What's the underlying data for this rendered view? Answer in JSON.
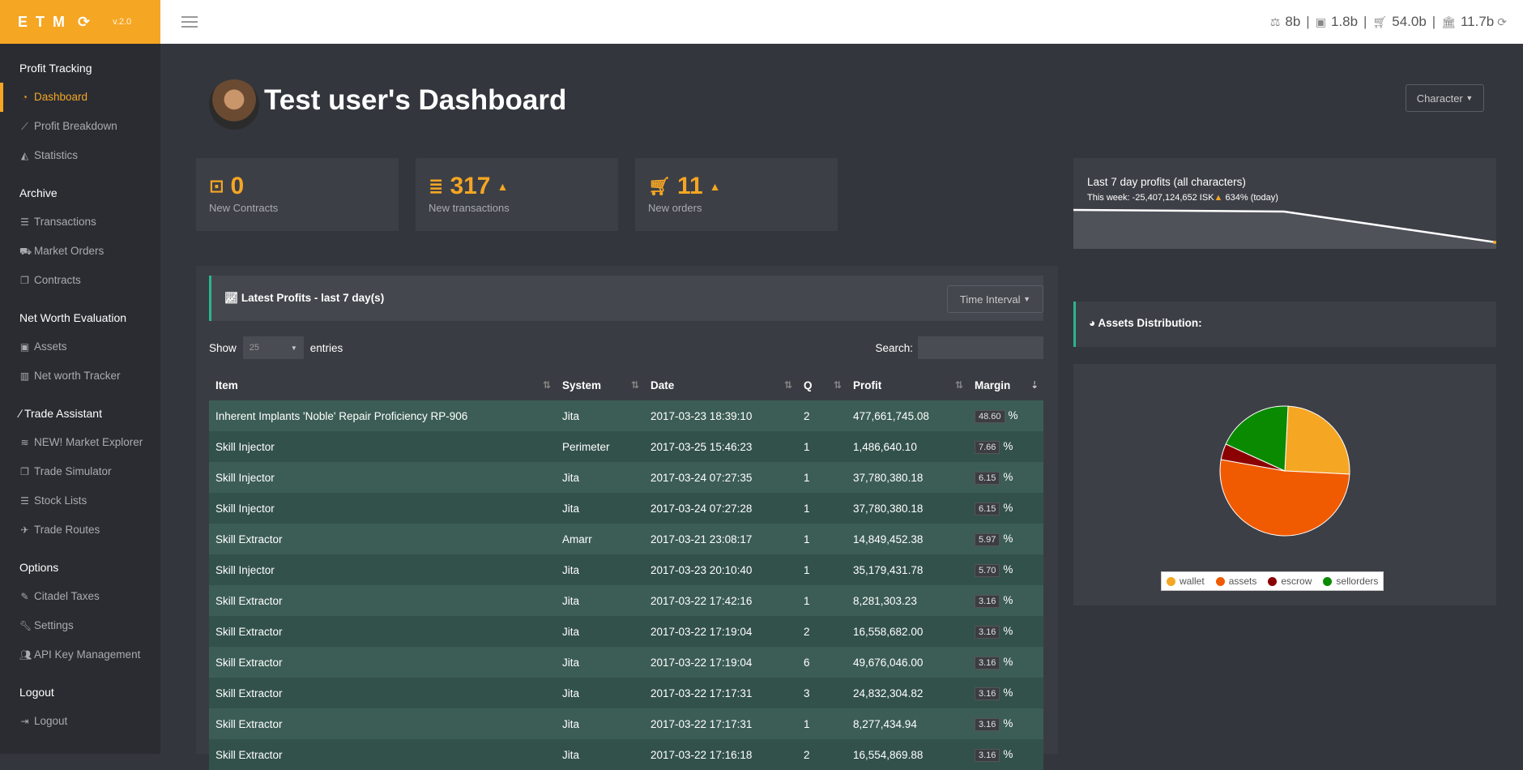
{
  "brand": {
    "name": "ETM",
    "version": "v.2.0"
  },
  "topbar": {
    "stats": [
      {
        "icon": "balance-icon",
        "value": "8b"
      },
      {
        "icon": "briefcase-icon",
        "value": "1.8b"
      },
      {
        "icon": "cart-icon",
        "value": "54.0b"
      },
      {
        "icon": "bank-icon",
        "value": "11.7b"
      }
    ]
  },
  "sidebar": {
    "sections": [
      {
        "title": "Profit Tracking",
        "items": [
          {
            "label": "Dashboard",
            "icon": "dashboard-icon",
            "active": true
          },
          {
            "label": "Profit Breakdown",
            "icon": "line-chart-icon"
          },
          {
            "label": "Statistics",
            "icon": "area-chart-icon"
          }
        ]
      },
      {
        "title": "Archive",
        "items": [
          {
            "label": "Transactions",
            "icon": "list-icon"
          },
          {
            "label": "Market Orders",
            "icon": "cart-icon"
          },
          {
            "label": "Contracts",
            "icon": "copy-icon"
          }
        ]
      },
      {
        "title": "Net Worth Evaluation",
        "items": [
          {
            "label": "Assets",
            "icon": "briefcase-icon"
          },
          {
            "label": "Net worth Tracker",
            "icon": "bar-chart-icon"
          }
        ]
      },
      {
        "title": "Trade Assistant",
        "items": [
          {
            "label": "NEW! Market Explorer",
            "icon": "database-icon"
          },
          {
            "label": "Trade Simulator",
            "icon": "copy-icon"
          },
          {
            "label": "Stock Lists",
            "icon": "list-icon"
          },
          {
            "label": "Trade Routes",
            "icon": "plane-icon"
          }
        ]
      },
      {
        "title": "Options",
        "items": [
          {
            "label": "Citadel Taxes",
            "icon": "pencil-icon"
          },
          {
            "label": "Settings",
            "icon": "wrench-icon"
          },
          {
            "label": "API Key Management",
            "icon": "users-icon"
          }
        ]
      },
      {
        "title": "Logout",
        "items": [
          {
            "label": "Logout",
            "icon": "sign-out-icon"
          }
        ]
      }
    ]
  },
  "header": {
    "title": "Test user's Dashboard",
    "character_button": "Character"
  },
  "cards": [
    {
      "icon": "contract-icon",
      "value": "0",
      "label": "New Contracts",
      "trend": ""
    },
    {
      "icon": "transactions-icon",
      "value": "317",
      "label": "New transactions",
      "trend": "up"
    },
    {
      "icon": "cart-icon",
      "value": "11",
      "label": "New orders",
      "trend": "up"
    }
  ],
  "profit_chart": {
    "title": "Last 7 day profits (all characters)",
    "subtitle_prefix": "This week: -25,407,124,652 ISK",
    "subtitle_suffix": "634% (today)"
  },
  "latest_profits": {
    "title": "Latest Profits - last 7 day(s)",
    "time_interval_button": "Time Interval",
    "show_label": "Show",
    "entries_value": "25",
    "entries_label": "entries",
    "search_label": "Search:",
    "columns": [
      "Item",
      "System",
      "Date",
      "Q",
      "Profit",
      "Margin"
    ],
    "rows": [
      [
        "Inherent Implants 'Noble' Repair Proficiency RP-906",
        "Jita",
        "2017-03-23 18:39:10",
        "2",
        "477,661,745.08",
        "48.60"
      ],
      [
        "Skill Injector",
        "Perimeter",
        "2017-03-25 15:46:23",
        "1",
        "1,486,640.10",
        "7.66"
      ],
      [
        "Skill Injector",
        "Jita",
        "2017-03-24 07:27:35",
        "1",
        "37,780,380.18",
        "6.15"
      ],
      [
        "Skill Injector",
        "Jita",
        "2017-03-24 07:27:28",
        "1",
        "37,780,380.18",
        "6.15"
      ],
      [
        "Skill Extractor",
        "Amarr",
        "2017-03-21 23:08:17",
        "1",
        "14,849,452.38",
        "5.97"
      ],
      [
        "Skill Injector",
        "Jita",
        "2017-03-23 20:10:40",
        "1",
        "35,179,431.78",
        "5.70"
      ],
      [
        "Skill Extractor",
        "Jita",
        "2017-03-22 17:42:16",
        "1",
        "8,281,303.23",
        "3.16"
      ],
      [
        "Skill Extractor",
        "Jita",
        "2017-03-22 17:19:04",
        "2",
        "16,558,682.00",
        "3.16"
      ],
      [
        "Skill Extractor",
        "Jita",
        "2017-03-22 17:19:04",
        "6",
        "49,676,046.00",
        "3.16"
      ],
      [
        "Skill Extractor",
        "Jita",
        "2017-03-22 17:17:31",
        "3",
        "24,832,304.82",
        "3.16"
      ],
      [
        "Skill Extractor",
        "Jita",
        "2017-03-22 17:17:31",
        "1",
        "8,277,434.94",
        "3.16"
      ],
      [
        "Skill Extractor",
        "Jita",
        "2017-03-22 17:16:18",
        "2",
        "16,554,869.88",
        "3.16"
      ]
    ],
    "percent_sign": "%"
  },
  "assets": {
    "title": "Assets Distribution:",
    "chart_data": {
      "type": "pie",
      "series": [
        {
          "name": "wallet",
          "value": 25,
          "color": "#f5a623"
        },
        {
          "name": "assets",
          "value": 52,
          "color": "#f05a00"
        },
        {
          "name": "escrow",
          "value": 4,
          "color": "#8b0000"
        },
        {
          "name": "sellorders",
          "value": 19,
          "color": "#0a8a00"
        }
      ]
    }
  }
}
